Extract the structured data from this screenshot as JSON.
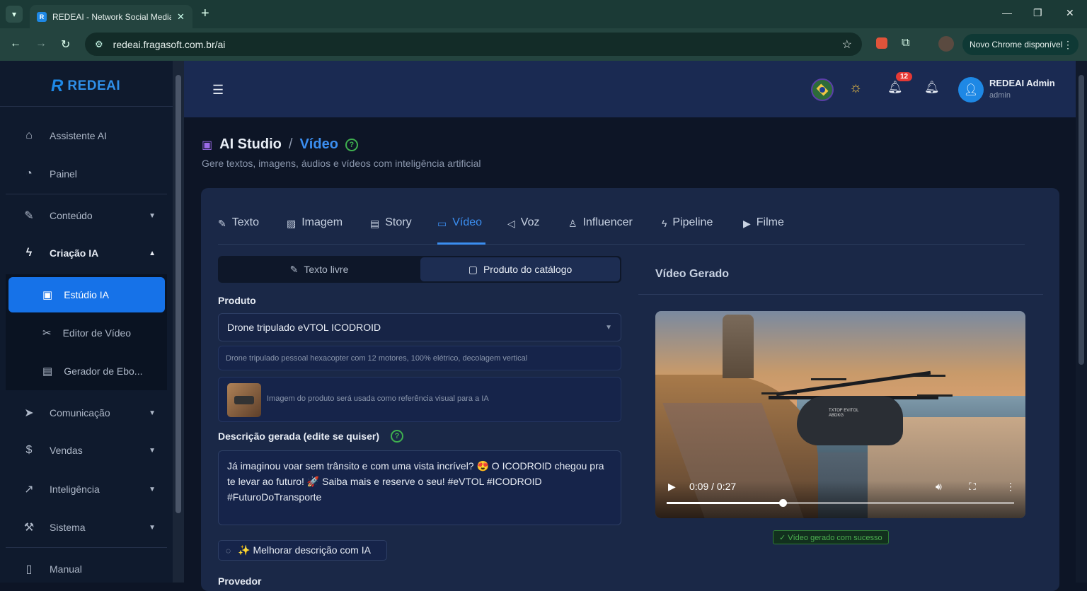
{
  "browser": {
    "tab_title": "REDEAI - Network Social Media",
    "url": "redeai.fragasoft.com.br/ai",
    "update_label": "Novo Chrome disponível"
  },
  "sidebar": {
    "logo_mark": "R",
    "logo_text": "REDEAI",
    "items": [
      {
        "label": "Assistente AI",
        "icon": "home-icon"
      },
      {
        "label": "Painel",
        "icon": "dashboard-icon"
      },
      {
        "label": "Conteúdo",
        "icon": "edit-icon"
      },
      {
        "label": "Criação IA",
        "icon": "bolt-icon"
      },
      {
        "label": "Comunicação",
        "icon": "send-icon"
      },
      {
        "label": "Vendas",
        "icon": "dollar-icon"
      },
      {
        "label": "Inteligência",
        "icon": "chart-icon"
      },
      {
        "label": "Sistema",
        "icon": "wrench-icon"
      },
      {
        "label": "Manual",
        "icon": "book-icon"
      }
    ],
    "submenu": [
      {
        "label": "Estúdio IA",
        "icon": "studio-icon"
      },
      {
        "label": "Editor de Vídeo",
        "icon": "scissors-icon"
      },
      {
        "label": "Gerador de Ebo...",
        "icon": "ebook-icon"
      }
    ]
  },
  "topbar": {
    "notification_count": "12",
    "user_name": "REDEAI Admin",
    "user_role": "admin"
  },
  "page": {
    "title_main": "AI Studio",
    "title_sep": "/",
    "title_current": "Vídeo",
    "subtitle": "Gere textos, imagens, áudios e vídeos com inteligência artificial"
  },
  "tabs": [
    {
      "label": "Texto",
      "icon": "pencil-icon"
    },
    {
      "label": "Imagem",
      "icon": "image-icon"
    },
    {
      "label": "Story",
      "icon": "document-icon"
    },
    {
      "label": "Vídeo",
      "icon": "video-icon"
    },
    {
      "label": "Voz",
      "icon": "speaker-icon"
    },
    {
      "label": "Influencer",
      "icon": "person-icon"
    },
    {
      "label": "Pipeline",
      "icon": "bolt-icon"
    },
    {
      "label": "Filme",
      "icon": "film-icon"
    }
  ],
  "form": {
    "mode_free": "Texto livre",
    "mode_catalog": "Produto do catálogo",
    "product_label": "Produto",
    "product_value": "Drone tripulado eVTOL ICODROID",
    "product_description": "Drone tripulado pessoal hexacopter com 12 motores, 100% elétrico, decolagem vertical",
    "image_note": "Imagem do produto será usada como referência visual para a IA",
    "desc_label": "Descrição gerada (edite se quiser)",
    "desc_value": "Já imaginou voar sem trânsito e com uma vista incrível? 😍 O ICODROID chegou pra te levar ao futuro! 🚀 Saiba mais e reserve o seu! #eVTOL #ICODROID #FuturoDoTransporte",
    "improve_label": "✨ Melhorar descrição com IA",
    "provider_label": "Provedor"
  },
  "video": {
    "title": "Vídeo Gerado",
    "time": "0:09 / 0:27",
    "progress": 0.333,
    "drone_label": "TXTOF EVITOL ABDKG",
    "success": "✓ Vídeo gerado com sucesso"
  }
}
